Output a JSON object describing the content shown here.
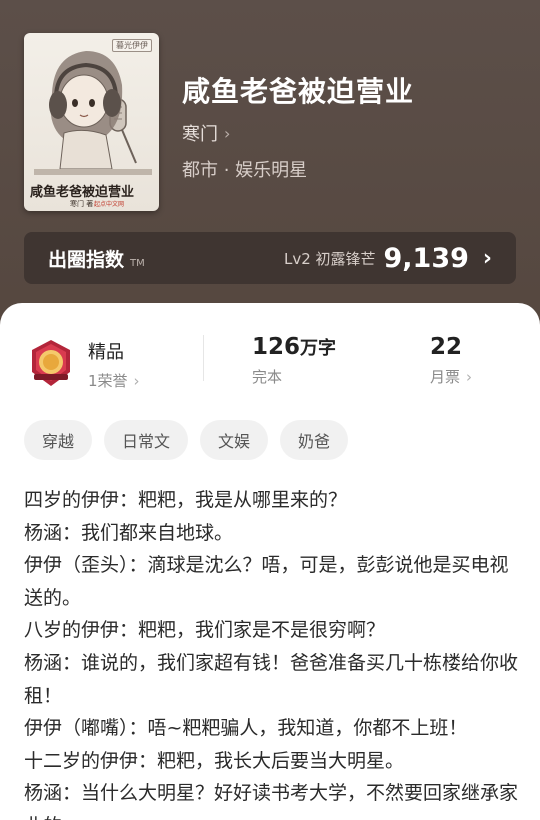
{
  "book": {
    "cover": {
      "badge": "暮光伊伊",
      "title": "咸鱼老爸被迫营业",
      "author": "寒门 著",
      "publisher": "起点中文网"
    },
    "title": "咸鱼老爸被迫营业",
    "author": "寒门",
    "genre": "都市 · 娱乐明星"
  },
  "index": {
    "label": "出圈指数",
    "tm": "TM",
    "level": "Lv2 初露锋芒",
    "value": "9,139"
  },
  "stats": {
    "quality": {
      "title": "精品",
      "sub": "1荣誉"
    },
    "words": {
      "number": "126",
      "unit": "万字",
      "sub": "完本"
    },
    "tickets": {
      "number": "22",
      "sub": "月票"
    }
  },
  "tags": [
    "穿越",
    "日常文",
    "文娱",
    "奶爸"
  ],
  "synopsis": [
    "四岁的伊伊：粑粑，我是从哪里来的？",
    "杨涵：我们都来自地球。",
    "伊伊（歪头）：滴球是沈么？唔，可是，彭彭说他是买电视送的。",
    "八岁的伊伊：粑粑，我们家是不是很穷啊？",
    "杨涵：谁说的，我们家超有钱！爸爸准备买几十栋楼给你收租！",
    "伊伊（嘟嘴）：唔~粑粑骗人，我知道，你都不上班！",
    "十二岁的伊伊：粑粑，我长大后要当大明星。",
    "杨涵：当什么大明星？好好读书考大学，不然要回家继承家业的。"
  ],
  "colors": {
    "accent": "#ffffff",
    "sheet": "#ffffff",
    "header": "#5a4d47"
  },
  "icons": {
    "author_chevron": "chevron-right-icon",
    "index_chevron": "chevron-right-icon",
    "quality_badge": "quality-badge-icon"
  }
}
